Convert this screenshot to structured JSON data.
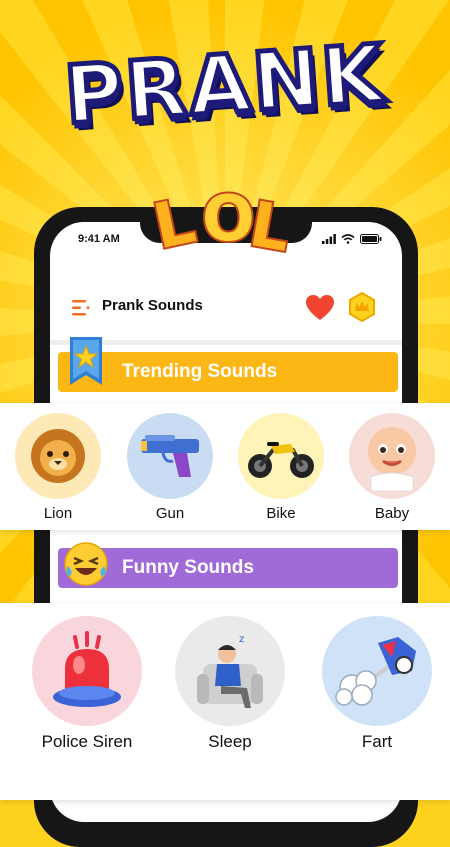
{
  "promo": {
    "headline": "PRANK",
    "badge": "LOL"
  },
  "status_bar": {
    "time": "9:41 AM"
  },
  "app_bar": {
    "title": "Prank Sounds",
    "menu_icon": "menu-icon",
    "favorites_icon": "heart-icon",
    "premium_icon": "crown-icon"
  },
  "sections": {
    "trending": {
      "title": "Trending Sounds",
      "color": "#fdb714",
      "items": [
        {
          "label": "Lion",
          "icon": "lion-icon",
          "bg": "#fde9b6"
        },
        {
          "label": "Gun",
          "icon": "gun-icon",
          "bg": "#c9dcf3"
        },
        {
          "label": "Bike",
          "icon": "motorbike-icon",
          "bg": "#fff3b8"
        },
        {
          "label": "Baby",
          "icon": "baby-icon",
          "bg": "#f7dcd8"
        }
      ]
    },
    "funny": {
      "title": "Funny Sounds",
      "color": "#a06ad8",
      "items": [
        {
          "label": "Police Siren",
          "icon": "siren-icon",
          "bg": "#f9d6dc"
        },
        {
          "label": "Sleep",
          "icon": "sleeping-man-icon",
          "bg": "#eaeaea"
        },
        {
          "label": "Fart",
          "icon": "fart-icon",
          "bg": "#cfe2f7"
        }
      ]
    }
  }
}
